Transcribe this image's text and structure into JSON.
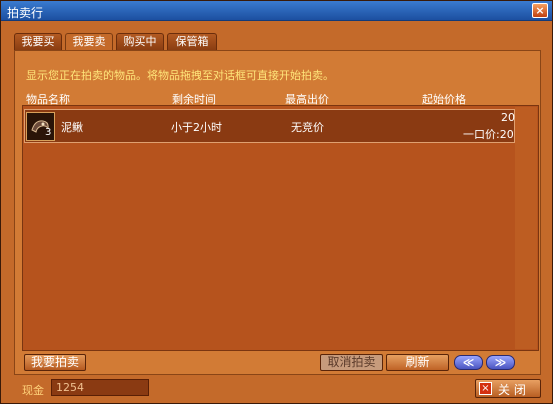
{
  "window": {
    "title": "拍卖行"
  },
  "tabs": [
    {
      "label": "我要买",
      "active": false
    },
    {
      "label": "我要卖",
      "active": true
    },
    {
      "label": "购买中",
      "active": false
    },
    {
      "label": "保管箱",
      "active": false
    }
  ],
  "notice": "显示您正在拍卖的物品。将物品拖拽至对话框可直接开始拍卖。",
  "columns": [
    "物品名称",
    "剩余时间",
    "最高出价",
    "起始价格"
  ],
  "listings": [
    {
      "icon": "leech-icon",
      "icon_count": "3",
      "name": "泥鳅",
      "time_left": "小于2小时",
      "highest_bid": "无竞价",
      "start_price": "20",
      "buyout": "一口价:20"
    }
  ],
  "buttons": {
    "sell": "我要拍卖",
    "cancel": "取消拍卖",
    "refresh": "刷新",
    "prev": "≪",
    "next": "≫",
    "close": "关 闭"
  },
  "cash": {
    "label": "现金",
    "value": "1254"
  },
  "colors": {
    "panel": "#d27b35",
    "notice": "#ffe57a",
    "titlebar": "#2a63b8"
  }
}
